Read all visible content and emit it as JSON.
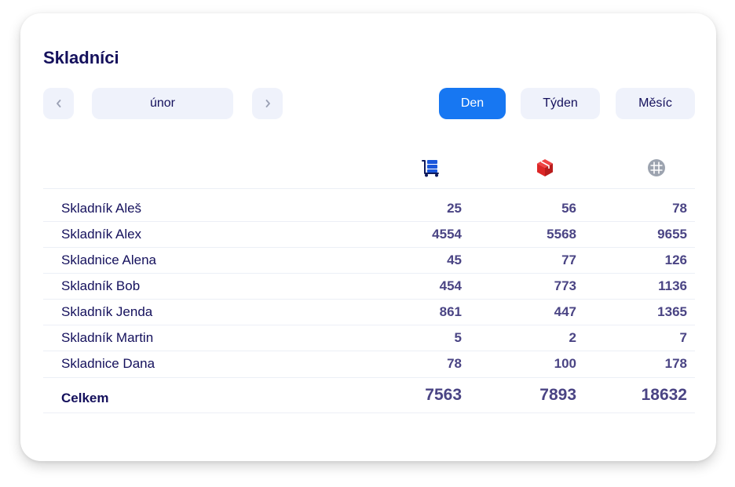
{
  "title": "Skladníci",
  "controls": {
    "prev_label": "‹",
    "next_label": "›",
    "month": "únor",
    "periods": [
      "Den",
      "Týden",
      "Měsíc"
    ],
    "active_period": "Den"
  },
  "columns": {
    "icons": [
      "trolley-boxes-icon",
      "red-package-icon",
      "globe-icon"
    ],
    "colors": {
      "trolley": "#1a56db",
      "package": "#e02424",
      "globe": "#9ca3af"
    }
  },
  "rows": [
    {
      "name": "Skladník Aleš",
      "values": [
        "25",
        "56",
        "78"
      ]
    },
    {
      "name": "Skladník Alex",
      "values": [
        "4554",
        "5568",
        "9655"
      ]
    },
    {
      "name": "Skladnice Alena",
      "values": [
        "45",
        "77",
        "126"
      ]
    },
    {
      "name": "Skladník Bob",
      "values": [
        "454",
        "773",
        "1136"
      ]
    },
    {
      "name": "Skladník Jenda",
      "values": [
        "861",
        "447",
        "1365"
      ]
    },
    {
      "name": "Skladník Martin",
      "values": [
        "5",
        "2",
        "7"
      ]
    },
    {
      "name": "Skladnice Dana",
      "values": [
        "78",
        "100",
        "178"
      ]
    }
  ],
  "total": {
    "label": "Celkem",
    "values": [
      "7563",
      "7893",
      "18632"
    ]
  },
  "accent_color": "#1777f2"
}
